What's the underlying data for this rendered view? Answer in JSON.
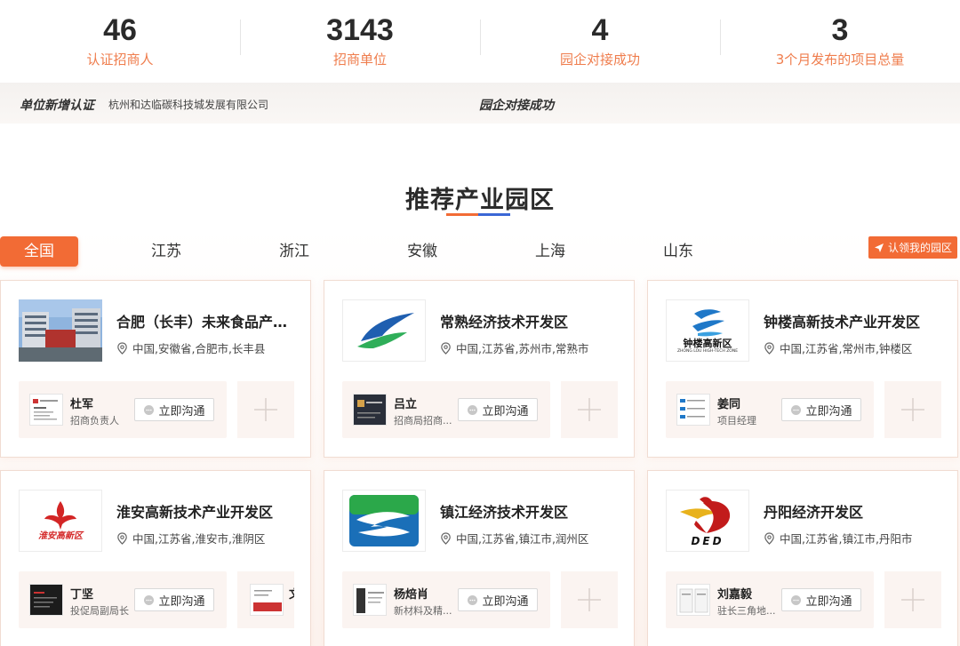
{
  "stats": [
    {
      "value": "46",
      "label": "认证招商人"
    },
    {
      "value": "3143",
      "label": "招商单位"
    },
    {
      "value": "4",
      "label": "园企对接成功"
    },
    {
      "value": "3",
      "label": "3个月发布的项目总量"
    }
  ],
  "news": {
    "left_title": "单位新增认证",
    "left_text": "杭州和达临碳科技城发展有限公司",
    "right_title": "园企对接成功"
  },
  "section": {
    "title": "推荐产业园区"
  },
  "tabs": [
    "全国",
    "江苏",
    "浙江",
    "安徽",
    "上海",
    "山东"
  ],
  "claim_button": "认领我的园区",
  "chat_label": "立即沟通",
  "cards": [
    {
      "name": "合肥（长丰）未来食品产业园",
      "location": "中国,安徽省,合肥市,长丰县",
      "contact_name": "杜军",
      "contact_role": "招商负责人"
    },
    {
      "name": "常熟经济技术开发区",
      "location": "中国,江苏省,苏州市,常熟市",
      "contact_name": "吕立",
      "contact_role": "招商局招商..."
    },
    {
      "name": "钟楼高新技术产业开发区",
      "location": "中国,江苏省,常州市,钟楼区",
      "contact_name": "姜同",
      "contact_role": "项目经理",
      "logo_text": "钟楼高新区",
      "logo_sub": "ZHONG LOU HIGH-TECH ZONE"
    },
    {
      "name": "淮安高新技术产业开发区",
      "location": "中国,江苏省,淮安市,淮阴区",
      "contact_name": "丁坚",
      "contact_role": "投促局副局长",
      "logo_text": "淮安高新区",
      "extra_contact_name": "文"
    },
    {
      "name": "镇江经济技术开发区",
      "location": "中国,江苏省,镇江市,润州区",
      "contact_name": "杨焙肖",
      "contact_role": "新材料及精..."
    },
    {
      "name": "丹阳经济开发区",
      "location": "中国,江苏省,镇江市,丹阳市",
      "contact_name": "刘嘉毅",
      "contact_role": "驻长三角地...",
      "logo_text": "DED"
    }
  ],
  "colors": {
    "accent": "#f26b35",
    "stat_label": "#ef7d4d",
    "underline_blue": "#3a67d6"
  }
}
